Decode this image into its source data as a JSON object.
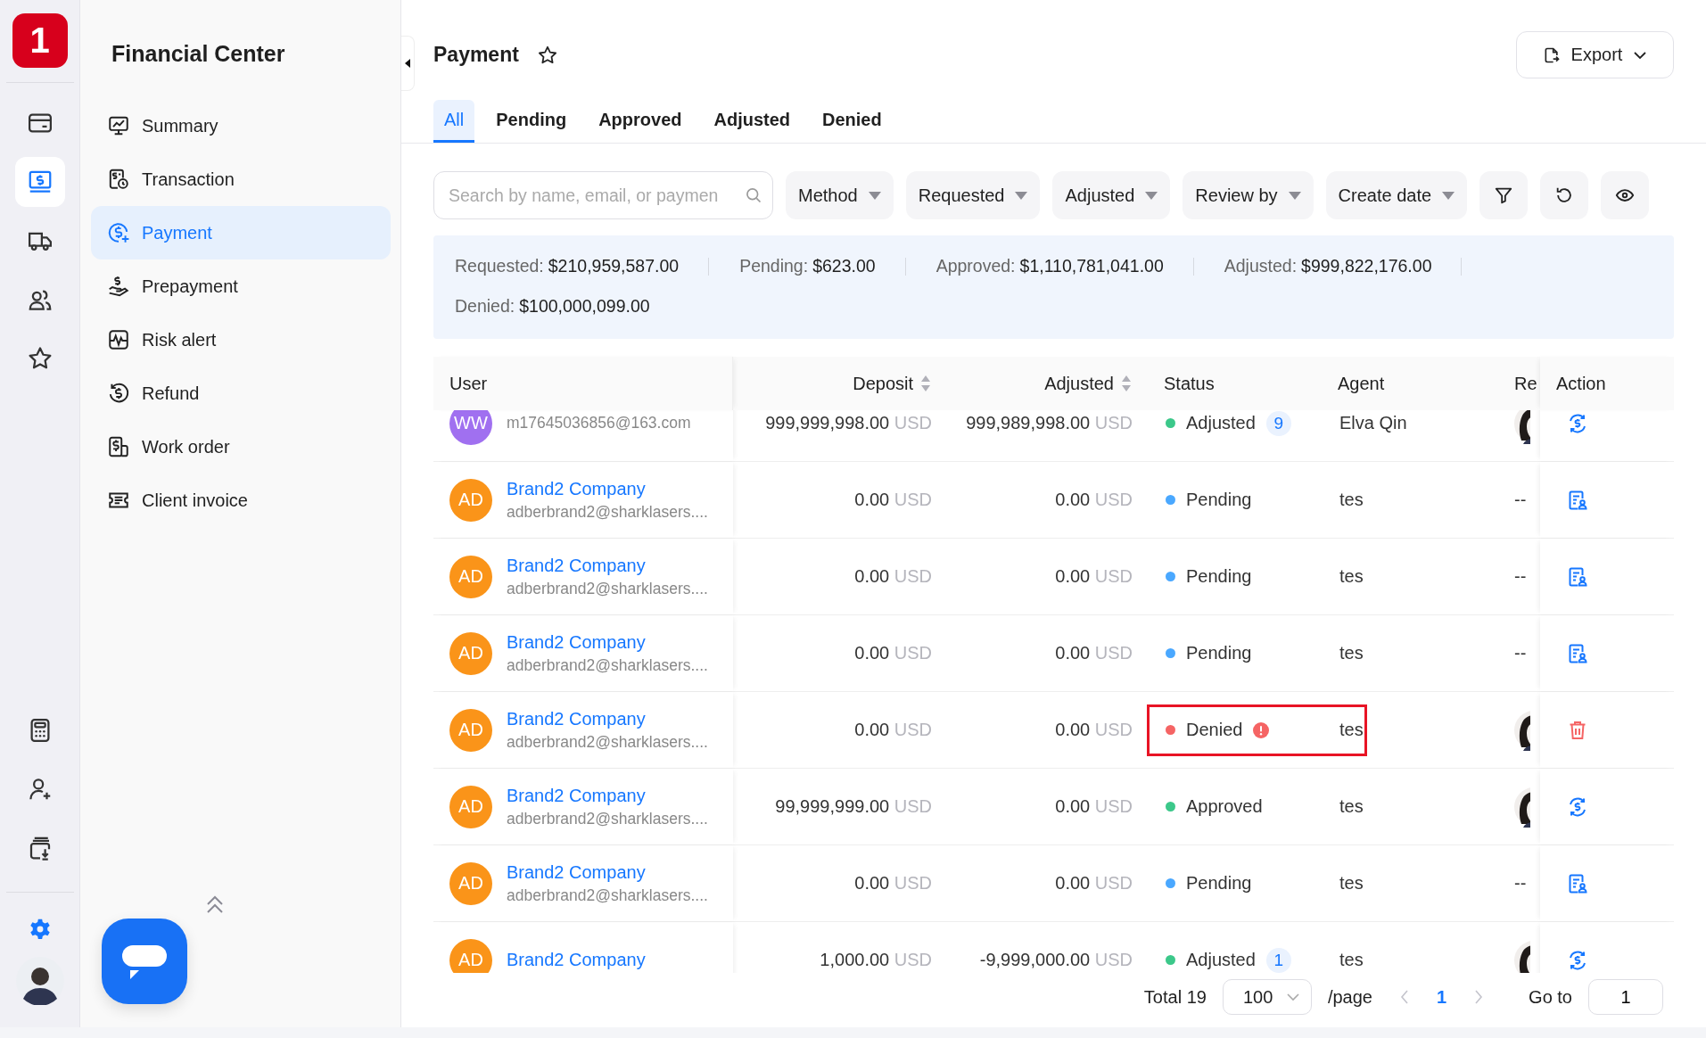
{
  "rail": {
    "logo": "1",
    "top_items": [
      {
        "kind": "card",
        "selected": false
      },
      {
        "kind": "dollar-screen",
        "selected": true
      },
      {
        "kind": "truck",
        "selected": false
      },
      {
        "kind": "users",
        "selected": false
      },
      {
        "kind": "star",
        "selected": false
      }
    ],
    "bottom_items": [
      {
        "kind": "calculator",
        "selected": false
      },
      {
        "kind": "user-plus",
        "selected": false
      },
      {
        "kind": "download",
        "selected": false
      }
    ]
  },
  "sidebar": {
    "title": "Financial Center",
    "items": [
      {
        "kind": "summary",
        "label": "Summary",
        "selected": false
      },
      {
        "kind": "transaction",
        "label": "Transaction",
        "selected": false
      },
      {
        "kind": "payment",
        "label": "Payment",
        "selected": true
      },
      {
        "kind": "prepayment",
        "label": "Prepayment",
        "selected": false
      },
      {
        "kind": "risk",
        "label": "Risk alert",
        "selected": false
      },
      {
        "kind": "refund",
        "label": "Refund",
        "selected": false
      },
      {
        "kind": "work",
        "label": "Work order",
        "selected": false
      },
      {
        "kind": "invoice",
        "label": "Client invoice",
        "selected": false
      }
    ]
  },
  "page": {
    "title": "Payment",
    "favorite": false,
    "export": "Export"
  },
  "tabs": [
    {
      "label": "All",
      "selected": true
    },
    {
      "label": "Pending",
      "selected": false
    },
    {
      "label": "Approved",
      "selected": false
    },
    {
      "label": "Adjusted",
      "selected": false
    },
    {
      "label": "Denied",
      "selected": false
    }
  ],
  "filters": {
    "search_placeholder": "Search by name, email, or paymen",
    "dropdowns": [
      "Method",
      "Requested",
      "Adjusted",
      "Review by",
      "Create date"
    ]
  },
  "summary": [
    {
      "label": "Requested:",
      "value": "$210,959,587.00"
    },
    {
      "label": "Pending:",
      "value": "$623.00"
    },
    {
      "label": "Approved:",
      "value": "$1,110,781,041.00"
    },
    {
      "label": "Adjusted:",
      "value": "$999,822,176.00"
    },
    {
      "label": "Denied:",
      "value": "$100,000,099.00"
    }
  ],
  "table": {
    "columns": [
      {
        "label": "User",
        "sortable": false
      },
      {
        "label": "Deposit",
        "sortable": true
      },
      {
        "label": "Adjusted",
        "sortable": true
      },
      {
        "label": "Status",
        "sortable": false
      },
      {
        "label": "Agent",
        "sortable": false
      },
      {
        "label": "Re",
        "sortable": false
      },
      {
        "label": "Action",
        "sortable": false
      }
    ],
    "rows": [
      {
        "avatar": "WW",
        "color": "#a070f0",
        "email": "m17645036856@163.com",
        "deposit": "999,999,998.00",
        "deposit_currency": "USD",
        "adjusted": "999,989,998.00",
        "adjusted_currency": "USD",
        "status": {
          "kind": "adjusted",
          "label": "Adjusted",
          "count": "9"
        },
        "agent": "Elva Qin",
        "reviewer": {
          "kind": "avatar"
        },
        "action": {
          "kind": "refund"
        }
      },
      {
        "avatar": "AD",
        "color": "#fa9419",
        "name": "Brand2 Company",
        "email": "adberbrand2@sharklasers....",
        "deposit": "0.00",
        "deposit_currency": "USD",
        "adjusted": "0.00",
        "adjusted_currency": "USD",
        "status": {
          "kind": "pending",
          "label": "Pending"
        },
        "agent": "tes",
        "reviewer": {
          "kind": "text",
          "text": "--"
        },
        "action": {
          "kind": "review"
        }
      },
      {
        "avatar": "AD",
        "color": "#fa9419",
        "name": "Brand2 Company",
        "email": "adberbrand2@sharklasers....",
        "deposit": "0.00",
        "deposit_currency": "USD",
        "adjusted": "0.00",
        "adjusted_currency": "USD",
        "status": {
          "kind": "pending",
          "label": "Pending"
        },
        "agent": "tes",
        "reviewer": {
          "kind": "text",
          "text": "--"
        },
        "action": {
          "kind": "review"
        }
      },
      {
        "avatar": "AD",
        "color": "#fa9419",
        "name": "Brand2 Company",
        "email": "adberbrand2@sharklasers....",
        "deposit": "0.00",
        "deposit_currency": "USD",
        "adjusted": "0.00",
        "adjusted_currency": "USD",
        "status": {
          "kind": "pending",
          "label": "Pending"
        },
        "agent": "tes",
        "reviewer": {
          "kind": "text",
          "text": "--"
        },
        "action": {
          "kind": "review"
        }
      },
      {
        "avatar": "AD",
        "color": "#fa9419",
        "name": "Brand2 Company",
        "email": "adberbrand2@sharklasers....",
        "deposit": "0.00",
        "deposit_currency": "USD",
        "adjusted": "0.00",
        "adjusted_currency": "USD",
        "status": {
          "kind": "denied",
          "label": "Denied",
          "warning": true
        },
        "agent": "tes",
        "reviewer": {
          "kind": "avatar"
        },
        "action": {
          "kind": "delete"
        },
        "highlighted": true
      },
      {
        "avatar": "AD",
        "color": "#fa9419",
        "name": "Brand2 Company",
        "email": "adberbrand2@sharklasers....",
        "deposit": "99,999,999.00",
        "deposit_currency": "USD",
        "adjusted": "0.00",
        "adjusted_currency": "USD",
        "status": {
          "kind": "approved",
          "label": "Approved"
        },
        "agent": "tes",
        "reviewer": {
          "kind": "avatar"
        },
        "action": {
          "kind": "refund"
        }
      },
      {
        "avatar": "AD",
        "color": "#fa9419",
        "name": "Brand2 Company",
        "email": "adberbrand2@sharklasers....",
        "deposit": "0.00",
        "deposit_currency": "USD",
        "adjusted": "0.00",
        "adjusted_currency": "USD",
        "status": {
          "kind": "pending",
          "label": "Pending"
        },
        "agent": "tes",
        "reviewer": {
          "kind": "text",
          "text": "--"
        },
        "action": {
          "kind": "review"
        }
      },
      {
        "avatar": "AD",
        "color": "#fa9419",
        "name": "Brand2 Company",
        "deposit": "1,000.00",
        "deposit_currency": "USD",
        "adjusted": "-9,999,000.00",
        "adjusted_currency": "USD",
        "status": {
          "kind": "adjusted",
          "label": "Adjusted",
          "count": "1"
        },
        "agent": "tes",
        "reviewer": {
          "kind": "avatar"
        },
        "action": {
          "kind": "refund"
        }
      }
    ]
  },
  "pagination": {
    "total": "Total 19",
    "page_size": "100",
    "per_page": "/page",
    "prev_disabled": true,
    "next_disabled": true,
    "pages": [
      {
        "label": "1",
        "selected": true
      }
    ],
    "goto_label": "Go to",
    "goto_value": "1"
  }
}
